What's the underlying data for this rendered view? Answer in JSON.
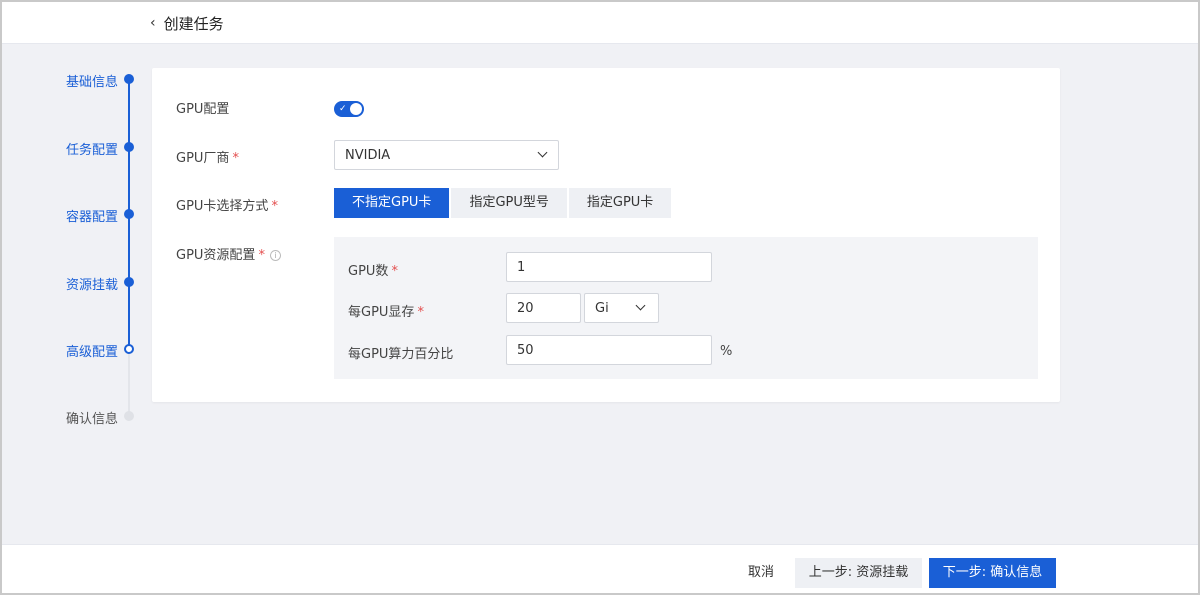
{
  "header": {
    "back_icon": "chevron-left-icon",
    "title": "创建任务"
  },
  "steps": [
    {
      "label": "基础信息",
      "state": "done"
    },
    {
      "label": "任务配置",
      "state": "done"
    },
    {
      "label": "容器配置",
      "state": "done"
    },
    {
      "label": "资源挂载",
      "state": "done"
    },
    {
      "label": "高级配置",
      "state": "current"
    },
    {
      "label": "确认信息",
      "state": "todo"
    }
  ],
  "form": {
    "gpu_config_label": "GPU配置",
    "gpu_config_enabled": true,
    "vendor_label": "GPU厂商",
    "vendor_value": "NVIDIA",
    "mode_label": "GPU卡选择方式",
    "mode_options": [
      "不指定GPU卡",
      "指定GPU型号",
      "指定GPU卡"
    ],
    "mode_selected": "不指定GPU卡",
    "resource_label": "GPU资源配置",
    "required_mark": "*",
    "resource": {
      "count_label": "GPU数",
      "count_value": "1",
      "memory_label": "每GPU显存",
      "memory_value": "20",
      "memory_unit": "Gi",
      "compute_label": "每GPU算力百分比",
      "compute_value": "50",
      "compute_unit": "%"
    }
  },
  "footer": {
    "cancel_label": "取消",
    "prev_label": "上一步: 资源挂载",
    "next_label": "下一步: 确认信息"
  },
  "colors": {
    "primary": "#1a5fd6",
    "required": "#e34d4d",
    "background": "#f0f1f5"
  }
}
